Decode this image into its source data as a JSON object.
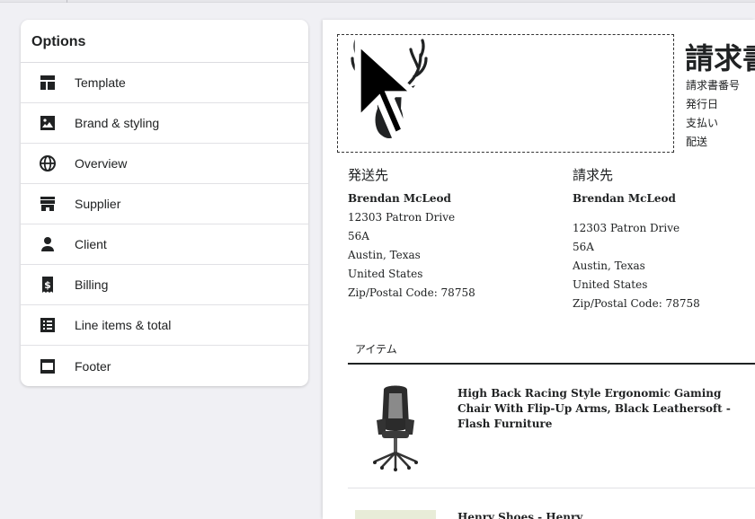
{
  "options": {
    "title": "Options",
    "items": [
      {
        "label": "Template",
        "icon": "template-icon"
      },
      {
        "label": "Brand & styling",
        "icon": "image-icon"
      },
      {
        "label": "Overview",
        "icon": "globe-icon"
      },
      {
        "label": "Supplier",
        "icon": "store-icon"
      },
      {
        "label": "Client",
        "icon": "person-icon"
      },
      {
        "label": "Billing",
        "icon": "receipt-icon"
      },
      {
        "label": "Line items & total",
        "icon": "list-icon"
      },
      {
        "label": "Footer",
        "icon": "footer-icon"
      }
    ]
  },
  "invoice": {
    "title": "請求書",
    "meta": [
      "請求書番号",
      "発行日",
      "支払い",
      "配送"
    ],
    "ship_to": {
      "heading": "発送先",
      "name": "Brendan McLeod",
      "street": "12303 Patron Drive",
      "unit": "56A",
      "city": "Austin, Texas",
      "country": "United States",
      "zip": "Zip/Postal Code: 78758"
    },
    "bill_to": {
      "heading": "請求先",
      "name": "Brendan McLeod",
      "street": "12303 Patron Drive",
      "unit": "56A",
      "city": "Austin, Texas",
      "country": "United States",
      "zip": "Zip/Postal Code: 78758"
    },
    "items_header": "アイテム",
    "items": [
      {
        "name": "High Back Racing Style Ergonomic Gaming Chair With Flip-Up Arms, Black Leathersoft - Flash Furniture"
      },
      {
        "name": "Henry Shoes - Henry"
      }
    ]
  }
}
